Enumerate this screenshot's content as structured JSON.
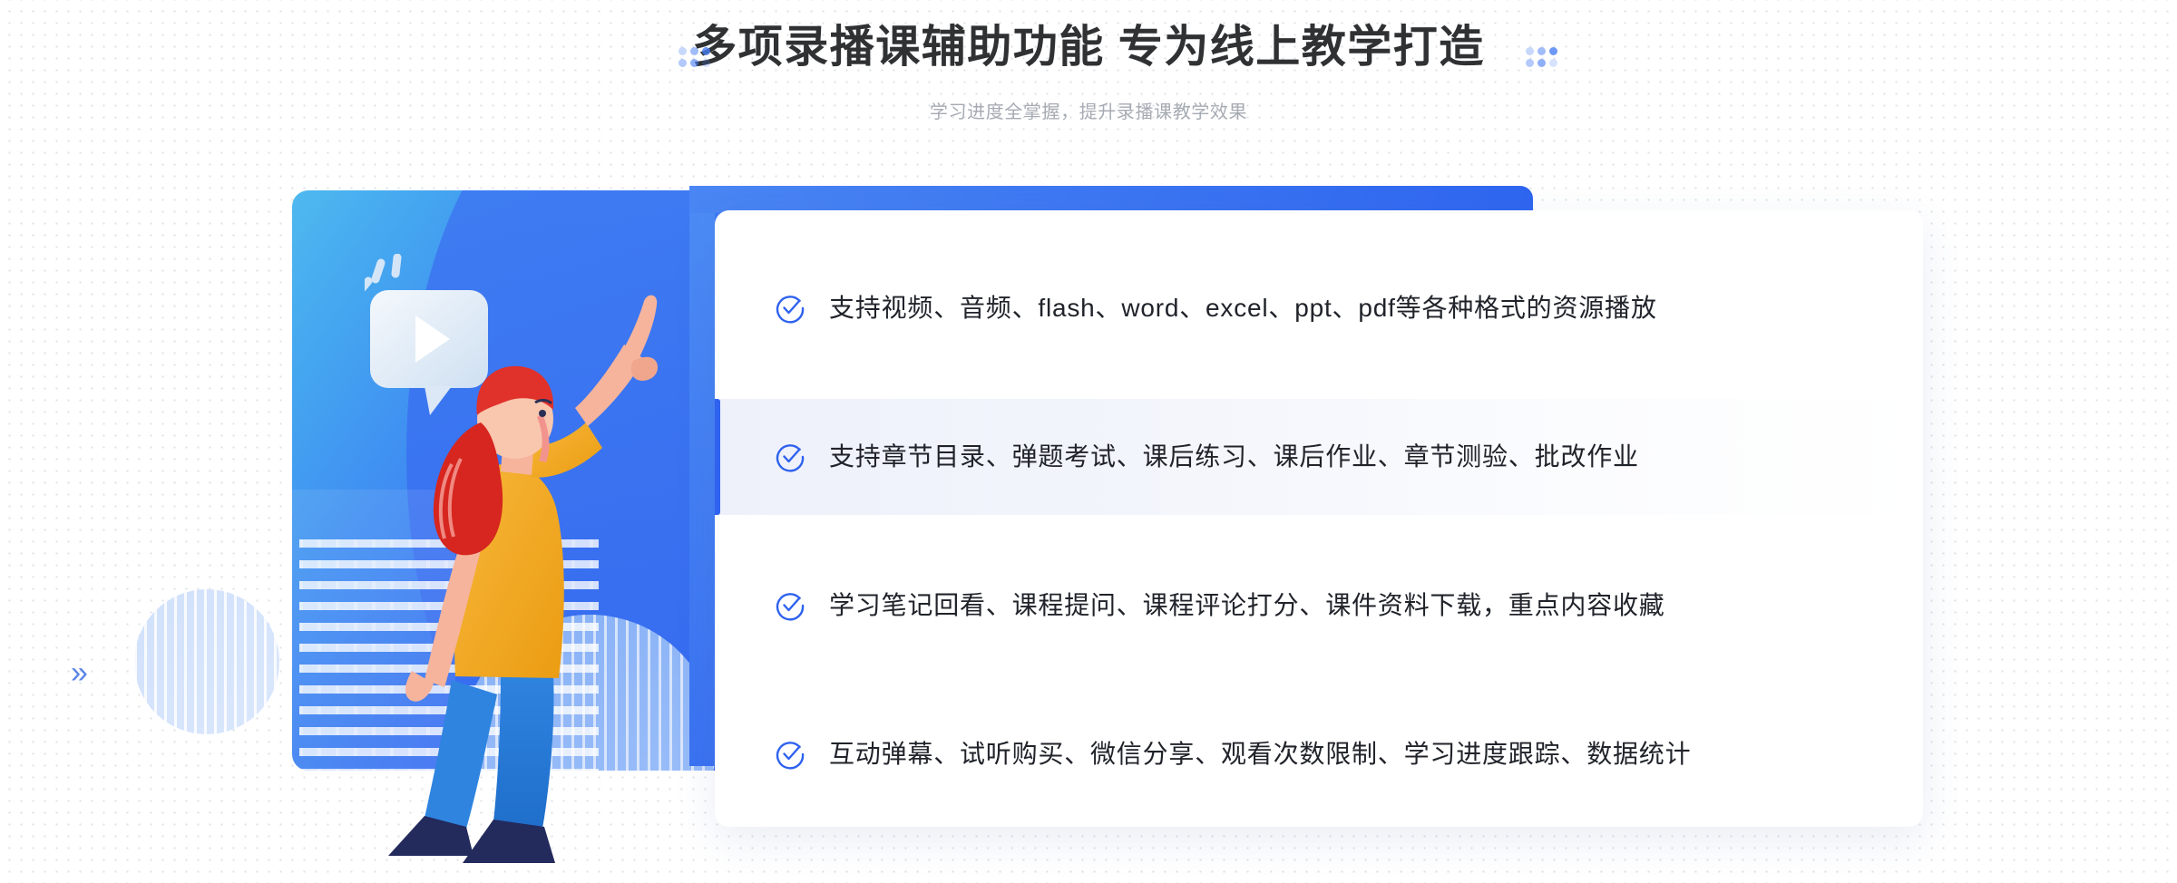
{
  "header": {
    "title": "多项录播课辅助功能 专为线上教学打造",
    "subtitle": "学习进度全掌握，提升录播课教学效果"
  },
  "decor": {
    "left_chevron": "»",
    "panel_chevron": "«"
  },
  "illustration": {
    "name": "woman-pointing-at-video-play-bubble",
    "play_bubble_label": "play-button-speech-bubble"
  },
  "features": [
    {
      "icon": "circle-check-icon",
      "text": "支持视频、音频、flash、word、excel、ppt、pdf等各种格式的资源播放",
      "highlighted": false
    },
    {
      "icon": "circle-check-icon",
      "text": "支持章节目录、弹题考试、课后练习、课后作业、章节测验、批改作业",
      "highlighted": true
    },
    {
      "icon": "circle-check-icon",
      "text": "学习笔记回看、课程提问、课程评论打分、课件资料下载，重点内容收藏",
      "highlighted": false
    },
    {
      "icon": "circle-check-icon",
      "text": "互动弹幕、试听购买、微信分享、观看次数限制、学习进度跟踪、数据统计",
      "highlighted": false
    }
  ],
  "colors": {
    "accent_blue": "#2f62ee",
    "title_gray": "#2f3133",
    "subtitle_gray": "#a6abb3",
    "panel_sky": "#4fb9ef",
    "panel_deep": "#3161ef",
    "shirt_orange": "#f5a623",
    "hair_red": "#e0312b",
    "pants_blue": "#2b7ddb",
    "shoe_navy": "#232a5c"
  }
}
